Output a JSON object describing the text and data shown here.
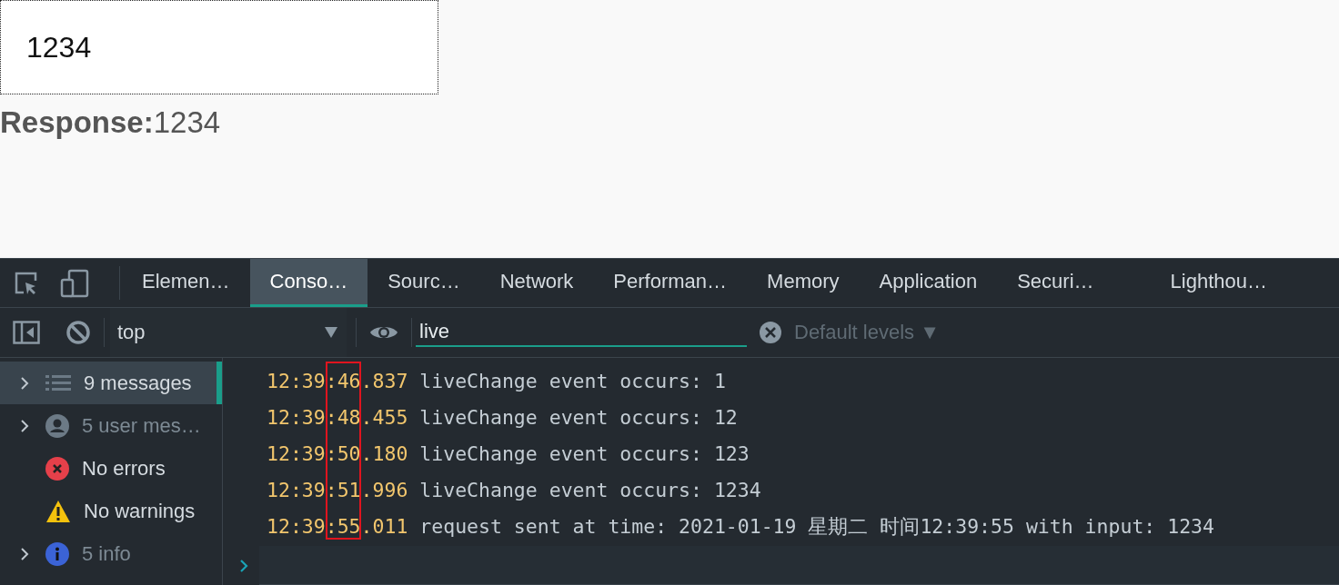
{
  "page": {
    "input_value": "1234",
    "response_label": "Response:",
    "response_value": "1234"
  },
  "devtools": {
    "tabs": [
      {
        "label": "Elemen…",
        "selected": false
      },
      {
        "label": "Conso…",
        "selected": true
      },
      {
        "label": "Sourc…",
        "selected": false
      },
      {
        "label": "Network",
        "selected": false
      },
      {
        "label": "Performan…",
        "selected": false
      },
      {
        "label": "Memory",
        "selected": false
      },
      {
        "label": "Application",
        "selected": false
      },
      {
        "label": "Securi…",
        "selected": false
      },
      {
        "label": "Lighthou…",
        "selected": false
      }
    ],
    "context": "top",
    "filter": {
      "value": "live"
    },
    "levels": "Default levels ▼",
    "sidebar": [
      {
        "kind": "list",
        "label": "9 messages",
        "expandable": true,
        "selected": true,
        "dimmed": false
      },
      {
        "kind": "user",
        "label": "5 user mes…",
        "expandable": true,
        "selected": false,
        "dimmed": true
      },
      {
        "kind": "error",
        "label": "No errors",
        "expandable": false,
        "selected": false,
        "dimmed": false
      },
      {
        "kind": "warning",
        "label": "No warnings",
        "expandable": false,
        "selected": false,
        "dimmed": false
      },
      {
        "kind": "info",
        "label": "5 info",
        "expandable": true,
        "selected": false,
        "dimmed": true
      }
    ],
    "messages": [
      {
        "time": "12:39:46.837",
        "text": "liveChange event occurs: 1"
      },
      {
        "time": "12:39:48.455",
        "text": "liveChange event occurs: 12"
      },
      {
        "time": "12:39:50.180",
        "text": "liveChange event occurs: 123"
      },
      {
        "time": "12:39:51.996",
        "text": "liveChange event occurs: 1234"
      },
      {
        "time": "12:39:55.011",
        "text": "request sent at time: 2021-01-19 星期二 时间12:39:55 with input: 1234"
      }
    ]
  }
}
